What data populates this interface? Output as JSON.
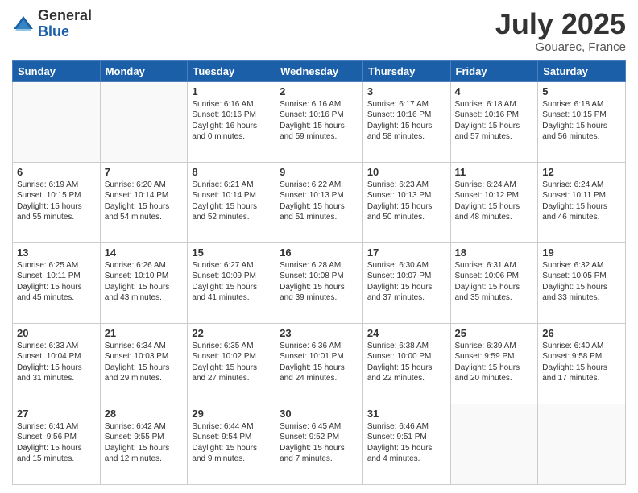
{
  "logo": {
    "general": "General",
    "blue": "Blue"
  },
  "title": "July 2025",
  "location": "Gouarec, France",
  "headers": [
    "Sunday",
    "Monday",
    "Tuesday",
    "Wednesday",
    "Thursday",
    "Friday",
    "Saturday"
  ],
  "weeks": [
    [
      {
        "day": "",
        "content": ""
      },
      {
        "day": "",
        "content": ""
      },
      {
        "day": "1",
        "content": "Sunrise: 6:16 AM\nSunset: 10:16 PM\nDaylight: 16 hours\nand 0 minutes."
      },
      {
        "day": "2",
        "content": "Sunrise: 6:16 AM\nSunset: 10:16 PM\nDaylight: 15 hours\nand 59 minutes."
      },
      {
        "day": "3",
        "content": "Sunrise: 6:17 AM\nSunset: 10:16 PM\nDaylight: 15 hours\nand 58 minutes."
      },
      {
        "day": "4",
        "content": "Sunrise: 6:18 AM\nSunset: 10:16 PM\nDaylight: 15 hours\nand 57 minutes."
      },
      {
        "day": "5",
        "content": "Sunrise: 6:18 AM\nSunset: 10:15 PM\nDaylight: 15 hours\nand 56 minutes."
      }
    ],
    [
      {
        "day": "6",
        "content": "Sunrise: 6:19 AM\nSunset: 10:15 PM\nDaylight: 15 hours\nand 55 minutes."
      },
      {
        "day": "7",
        "content": "Sunrise: 6:20 AM\nSunset: 10:14 PM\nDaylight: 15 hours\nand 54 minutes."
      },
      {
        "day": "8",
        "content": "Sunrise: 6:21 AM\nSunset: 10:14 PM\nDaylight: 15 hours\nand 52 minutes."
      },
      {
        "day": "9",
        "content": "Sunrise: 6:22 AM\nSunset: 10:13 PM\nDaylight: 15 hours\nand 51 minutes."
      },
      {
        "day": "10",
        "content": "Sunrise: 6:23 AM\nSunset: 10:13 PM\nDaylight: 15 hours\nand 50 minutes."
      },
      {
        "day": "11",
        "content": "Sunrise: 6:24 AM\nSunset: 10:12 PM\nDaylight: 15 hours\nand 48 minutes."
      },
      {
        "day": "12",
        "content": "Sunrise: 6:24 AM\nSunset: 10:11 PM\nDaylight: 15 hours\nand 46 minutes."
      }
    ],
    [
      {
        "day": "13",
        "content": "Sunrise: 6:25 AM\nSunset: 10:11 PM\nDaylight: 15 hours\nand 45 minutes."
      },
      {
        "day": "14",
        "content": "Sunrise: 6:26 AM\nSunset: 10:10 PM\nDaylight: 15 hours\nand 43 minutes."
      },
      {
        "day": "15",
        "content": "Sunrise: 6:27 AM\nSunset: 10:09 PM\nDaylight: 15 hours\nand 41 minutes."
      },
      {
        "day": "16",
        "content": "Sunrise: 6:28 AM\nSunset: 10:08 PM\nDaylight: 15 hours\nand 39 minutes."
      },
      {
        "day": "17",
        "content": "Sunrise: 6:30 AM\nSunset: 10:07 PM\nDaylight: 15 hours\nand 37 minutes."
      },
      {
        "day": "18",
        "content": "Sunrise: 6:31 AM\nSunset: 10:06 PM\nDaylight: 15 hours\nand 35 minutes."
      },
      {
        "day": "19",
        "content": "Sunrise: 6:32 AM\nSunset: 10:05 PM\nDaylight: 15 hours\nand 33 minutes."
      }
    ],
    [
      {
        "day": "20",
        "content": "Sunrise: 6:33 AM\nSunset: 10:04 PM\nDaylight: 15 hours\nand 31 minutes."
      },
      {
        "day": "21",
        "content": "Sunrise: 6:34 AM\nSunset: 10:03 PM\nDaylight: 15 hours\nand 29 minutes."
      },
      {
        "day": "22",
        "content": "Sunrise: 6:35 AM\nSunset: 10:02 PM\nDaylight: 15 hours\nand 27 minutes."
      },
      {
        "day": "23",
        "content": "Sunrise: 6:36 AM\nSunset: 10:01 PM\nDaylight: 15 hours\nand 24 minutes."
      },
      {
        "day": "24",
        "content": "Sunrise: 6:38 AM\nSunset: 10:00 PM\nDaylight: 15 hours\nand 22 minutes."
      },
      {
        "day": "25",
        "content": "Sunrise: 6:39 AM\nSunset: 9:59 PM\nDaylight: 15 hours\nand 20 minutes."
      },
      {
        "day": "26",
        "content": "Sunrise: 6:40 AM\nSunset: 9:58 PM\nDaylight: 15 hours\nand 17 minutes."
      }
    ],
    [
      {
        "day": "27",
        "content": "Sunrise: 6:41 AM\nSunset: 9:56 PM\nDaylight: 15 hours\nand 15 minutes."
      },
      {
        "day": "28",
        "content": "Sunrise: 6:42 AM\nSunset: 9:55 PM\nDaylight: 15 hours\nand 12 minutes."
      },
      {
        "day": "29",
        "content": "Sunrise: 6:44 AM\nSunset: 9:54 PM\nDaylight: 15 hours\nand 9 minutes."
      },
      {
        "day": "30",
        "content": "Sunrise: 6:45 AM\nSunset: 9:52 PM\nDaylight: 15 hours\nand 7 minutes."
      },
      {
        "day": "31",
        "content": "Sunrise: 6:46 AM\nSunset: 9:51 PM\nDaylight: 15 hours\nand 4 minutes."
      },
      {
        "day": "",
        "content": ""
      },
      {
        "day": "",
        "content": ""
      }
    ]
  ]
}
